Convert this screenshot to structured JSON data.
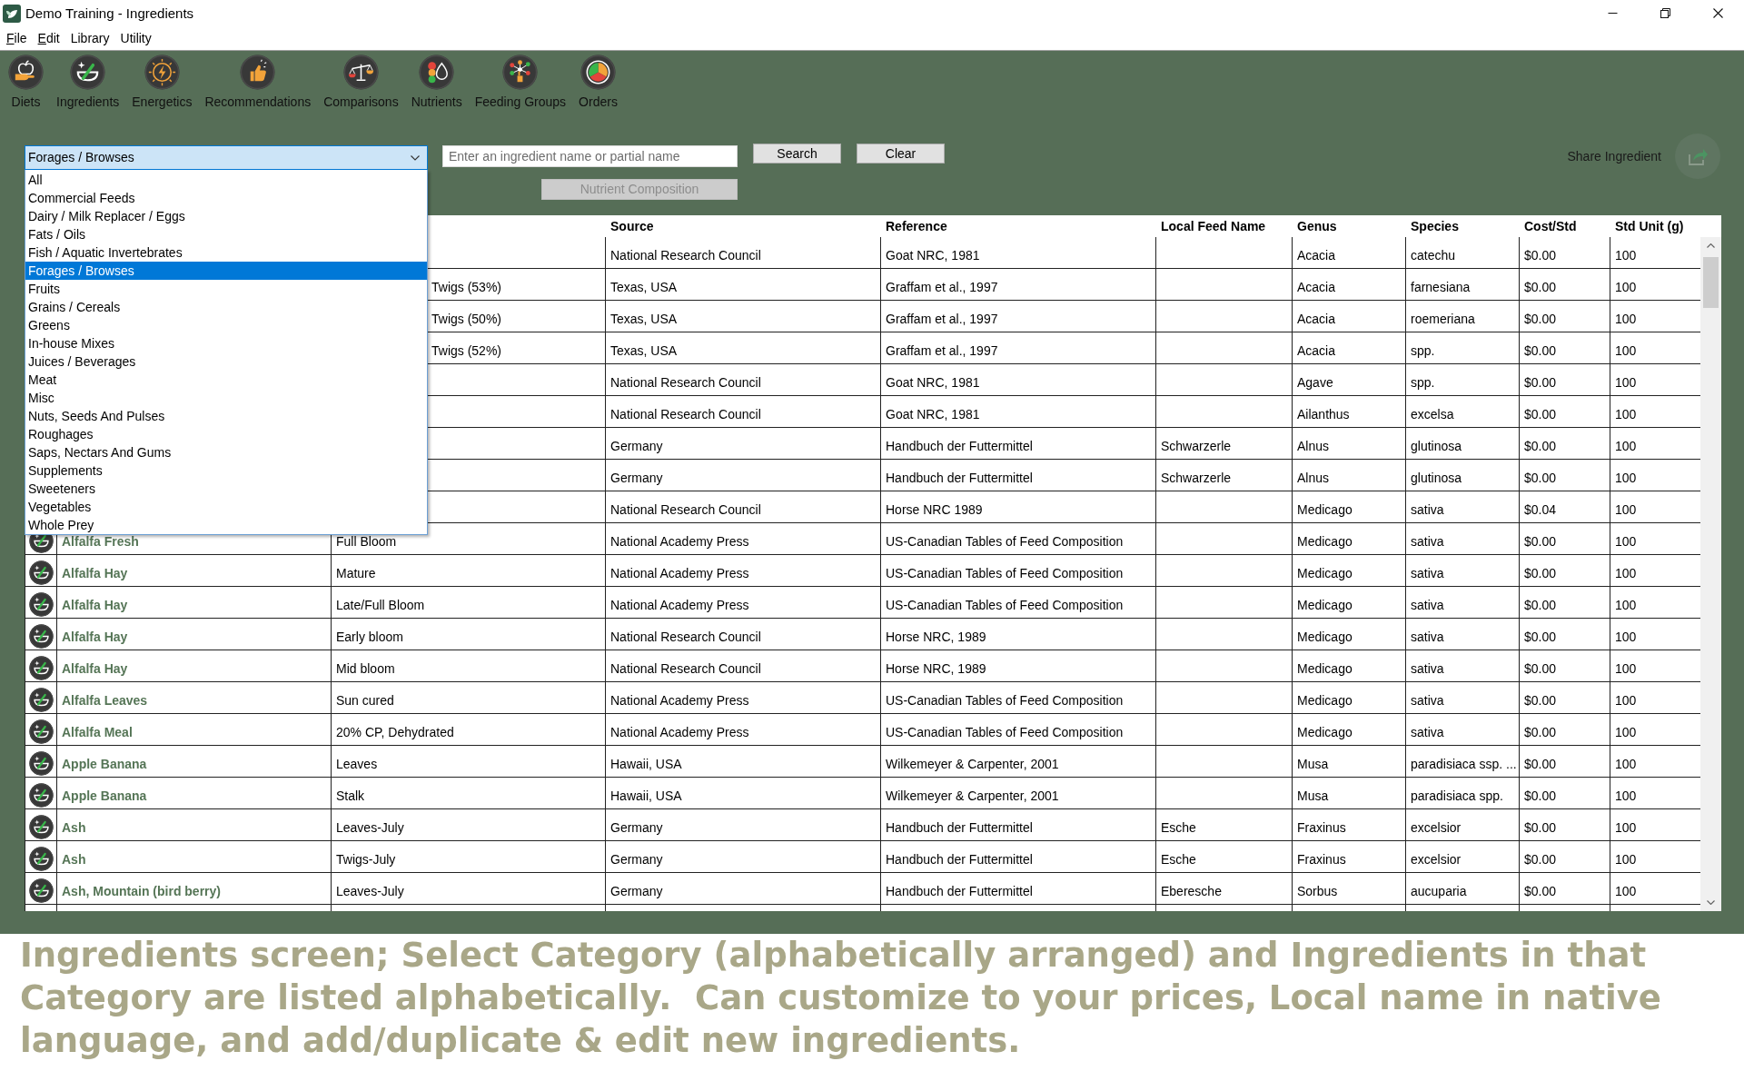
{
  "window": {
    "title": "Demo Training - Ingredients"
  },
  "menu": [
    {
      "label": "File",
      "mnemonic": true
    },
    {
      "label": "Edit",
      "mnemonic": true
    },
    {
      "label": "Library",
      "mnemonic": false
    },
    {
      "label": "Utility",
      "mnemonic": false
    }
  ],
  "toolbar": [
    {
      "label": "Diets"
    },
    {
      "label": "Ingredients"
    },
    {
      "label": "Energetics"
    },
    {
      "label": "Recommendations"
    },
    {
      "label": "Comparisons"
    },
    {
      "label": "Nutrients"
    },
    {
      "label": "Feeding Groups"
    },
    {
      "label": "Orders"
    }
  ],
  "filters": {
    "category": {
      "value": "Forages / Browses",
      "expanded": true,
      "options": [
        {
          "label": "All",
          "selected": false
        },
        {
          "label": "Commercial Feeds",
          "selected": false
        },
        {
          "label": "Dairy / Milk Replacer / Eggs",
          "selected": false
        },
        {
          "label": "Fats / Oils",
          "selected": false
        },
        {
          "label": "Fish / Aquatic Invertebrates",
          "selected": false
        },
        {
          "label": "Forages / Browses",
          "selected": true
        },
        {
          "label": "Fruits",
          "selected": false
        },
        {
          "label": "Grains / Cereals",
          "selected": false
        },
        {
          "label": "Greens",
          "selected": false
        },
        {
          "label": "In-house Mixes",
          "selected": false
        },
        {
          "label": "Juices / Beverages",
          "selected": false
        },
        {
          "label": "Meat",
          "selected": false
        },
        {
          "label": "Misc",
          "selected": false
        },
        {
          "label": "Nuts, Seeds And Pulses",
          "selected": false
        },
        {
          "label": "Roughages",
          "selected": false
        },
        {
          "label": "Saps, Nectars And Gums",
          "selected": false
        },
        {
          "label": "Supplements",
          "selected": false
        },
        {
          "label": "Sweeteners",
          "selected": false
        },
        {
          "label": "Vegetables",
          "selected": false
        },
        {
          "label": "Whole Prey",
          "selected": false
        }
      ]
    },
    "search": {
      "placeholder": "Enter an ingredient name or partial name"
    },
    "buttons": [
      {
        "label": "Search",
        "disabled": false
      },
      {
        "label": "Clear",
        "disabled": false
      }
    ],
    "nutrient_composition": {
      "label": "Nutrient Composition",
      "disabled": true
    }
  },
  "share": {
    "label": "Share Ingredient"
  },
  "table": {
    "columns": [
      "Source",
      "Reference",
      "Local Feed Name",
      "Genus",
      "Species",
      "Cost/Std",
      "Std Unit (g)"
    ],
    "rows": [
      {
        "source": "National Research Council",
        "reference": "Goat NRC, 1981",
        "genus": "Acacia",
        "species": "catechu",
        "cost_std": "$0.00",
        "std_unit_g": "100"
      },
      {
        "description": "Twigs (53%)",
        "source": "Texas, USA",
        "reference": "Graffam et al., 1997",
        "genus": "Acacia",
        "species": "farnesiana",
        "cost_std": "$0.00",
        "std_unit_g": "100"
      },
      {
        "description": "Twigs (50%)",
        "source": "Texas, USA",
        "reference": "Graffam et al., 1997",
        "genus": "Acacia",
        "species": "roemeriana",
        "cost_std": "$0.00",
        "std_unit_g": "100"
      },
      {
        "description": "Twigs (52%)",
        "source": "Texas, USA",
        "reference": "Graffam et al., 1997",
        "genus": "Acacia",
        "species": "spp.",
        "cost_std": "$0.00",
        "std_unit_g": "100"
      },
      {
        "source": "National Research Council",
        "reference": "Goat NRC, 1981",
        "genus": "Agave",
        "species": "spp.",
        "cost_std": "$0.00",
        "std_unit_g": "100"
      },
      {
        "source": "National Research Council",
        "reference": "Goat NRC, 1981",
        "genus": "Ailanthus",
        "species": "excelsa",
        "cost_std": "$0.00",
        "std_unit_g": "100"
      },
      {
        "source": "Germany",
        "reference": "Handbuch der Futtermittel",
        "local_feed_name": "Schwarzerle",
        "genus": "Alnus",
        "species": "glutinosa",
        "cost_std": "$0.00",
        "std_unit_g": "100"
      },
      {
        "source": "Germany",
        "reference": "Handbuch der Futtermittel",
        "local_feed_name": "Schwarzerle",
        "genus": "Alnus",
        "species": "glutinosa",
        "cost_std": "$0.00",
        "std_unit_g": "100"
      },
      {
        "source": "National Research Council",
        "reference": "Horse NRC 1989",
        "genus": "Medicago",
        "species": "sativa",
        "cost_std": "$0.04",
        "std_unit_g": "100"
      },
      {
        "name": "Alfalfa Fresh",
        "description": "Full Bloom",
        "source": "National Academy Press",
        "reference": "US-Canadian Tables of Feed Composition",
        "genus": "Medicago",
        "species": "sativa",
        "cost_std": "$0.00",
        "std_unit_g": "100"
      },
      {
        "name": "Alfalfa Hay",
        "description": "Mature",
        "source": "National Academy Press",
        "reference": "US-Canadian Tables of Feed Composition",
        "genus": "Medicago",
        "species": "sativa",
        "cost_std": "$0.00",
        "std_unit_g": "100"
      },
      {
        "name": "Alfalfa Hay",
        "description": "Late/Full Bloom",
        "source": "National Academy Press",
        "reference": "US-Canadian Tables of Feed Composition",
        "genus": "Medicago",
        "species": "sativa",
        "cost_std": "$0.00",
        "std_unit_g": "100"
      },
      {
        "name": "Alfalfa Hay",
        "description": "Early bloom",
        "source": "National Research Council",
        "reference": "Horse NRC, 1989",
        "genus": "Medicago",
        "species": "sativa",
        "cost_std": "$0.00",
        "std_unit_g": "100"
      },
      {
        "name": "Alfalfa Hay",
        "description": "Mid bloom",
        "source": "National Research Council",
        "reference": "Horse NRC, 1989",
        "genus": "Medicago",
        "species": "sativa",
        "cost_std": "$0.00",
        "std_unit_g": "100"
      },
      {
        "name": "Alfalfa Leaves",
        "description": "Sun cured",
        "source": "National Academy Press",
        "reference": "US-Canadian Tables of Feed Composition",
        "genus": "Medicago",
        "species": "sativa",
        "cost_std": "$0.00",
        "std_unit_g": "100"
      },
      {
        "name": "Alfalfa Meal",
        "description": "20% CP, Dehydrated",
        "source": "National Academy Press",
        "reference": "US-Canadian Tables of Feed Composition",
        "genus": "Medicago",
        "species": "sativa",
        "cost_std": "$0.00",
        "std_unit_g": "100"
      },
      {
        "name": "Apple Banana",
        "description": "Leaves",
        "source": "Hawaii, USA",
        "reference": "Wilkemeyer & Carpenter, 2001",
        "genus": "Musa",
        "species": "paradisiaca ssp. ...",
        "cost_std": "$0.00",
        "std_unit_g": "100"
      },
      {
        "name": "Apple Banana",
        "description": "Stalk",
        "source": "Hawaii, USA",
        "reference": "Wilkemeyer & Carpenter, 2001",
        "genus": "Musa",
        "species": "paradisiaca spp.",
        "cost_std": "$0.00",
        "std_unit_g": "100"
      },
      {
        "name": "Ash",
        "description": "Leaves-July",
        "source": "Germany",
        "reference": "Handbuch der Futtermittel",
        "local_feed_name": "Esche",
        "genus": "Fraxinus",
        "species": "excelsior",
        "cost_std": "$0.00",
        "std_unit_g": "100"
      },
      {
        "name": "Ash",
        "description": "Twigs-July",
        "source": "Germany",
        "reference": "Handbuch der Futtermittel",
        "local_feed_name": "Esche",
        "genus": "Fraxinus",
        "species": "excelsior",
        "cost_std": "$0.00",
        "std_unit_g": "100"
      },
      {
        "name": "Ash, Mountain (bird berry)",
        "description": "Leaves-July",
        "source": "Germany",
        "reference": "Handbuch der Futtermittel",
        "local_feed_name": "Eberesche",
        "genus": "Sorbus",
        "species": "aucuparia",
        "cost_std": "$0.00",
        "std_unit_g": "100"
      }
    ]
  },
  "caption": "Ingredients screen; Select Category (alphabetically arranged) and Ingredients in that Category are listed alphabetically.  Can customize to your prices, Local name in native language, and add/duplicate & edit new ingredients."
}
